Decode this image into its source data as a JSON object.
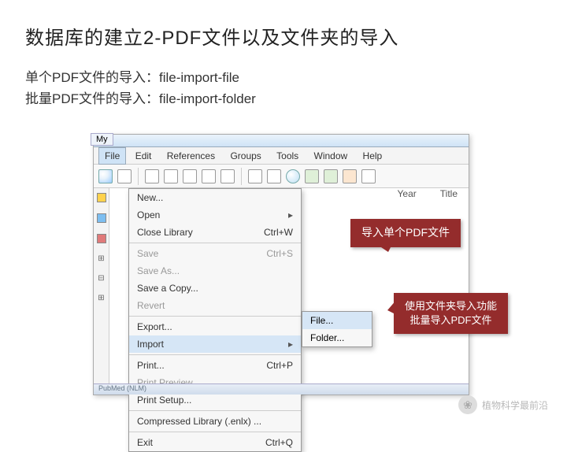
{
  "title": "数据库的建立2-PDF文件以及文件夹的导入",
  "sub1": "单个PDF文件的导入：file-import-file",
  "sub2": "批量PDF文件的导入：file-import-folder",
  "menubar": {
    "file": "File",
    "edit": "Edit",
    "references": "References",
    "groups": "Groups",
    "tools": "Tools",
    "window": "Window",
    "help": "Help"
  },
  "sidetab": "My",
  "cols": {
    "year": "Year",
    "title": "Title"
  },
  "menu": {
    "new": "New...",
    "open": "Open",
    "close": "Close Library",
    "close_k": "Ctrl+W",
    "save": "Save",
    "save_k": "Ctrl+S",
    "saveas": "Save As...",
    "savecopy": "Save a Copy...",
    "revert": "Revert",
    "export": "Export...",
    "import": "Import",
    "print": "Print...",
    "print_k": "Ctrl+P",
    "preview": "Print Preview",
    "setup": "Print Setup...",
    "compressed": "Compressed Library (.enlx) ...",
    "exit": "Exit",
    "exit_k": "Ctrl+Q"
  },
  "submenu": {
    "file": "File...",
    "folder": "Folder..."
  },
  "callout1": "导入单个PDF文件",
  "callout2a": "使用文件夹导入功能",
  "callout2b": "批量导入PDF文件",
  "status": "PubMed (NLM)",
  "watermark": "植物科学最前沿"
}
